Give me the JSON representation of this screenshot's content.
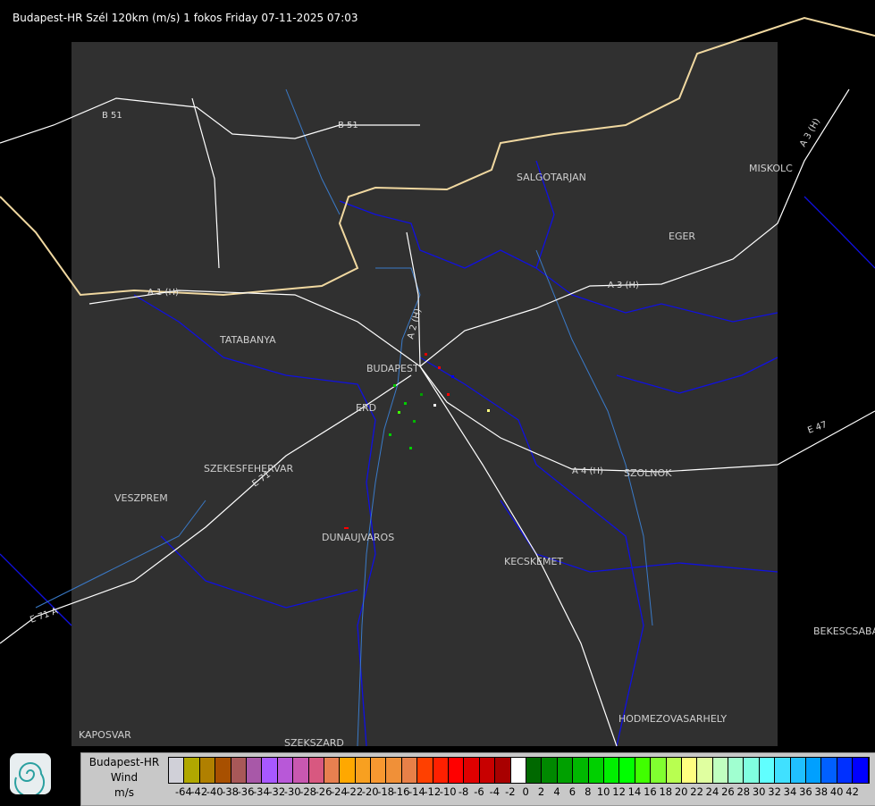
{
  "header": {
    "title": "Budapest-HR Szél 120km (m/s) 1 fokos Friday 07-11-2025 07:03"
  },
  "map": {
    "cities": [
      {
        "name": "SALGOTARJAN"
      },
      {
        "name": "MISKOLC"
      },
      {
        "name": "EGER"
      },
      {
        "name": "TATABANYA"
      },
      {
        "name": "BUDAPEST"
      },
      {
        "name": "ERD"
      },
      {
        "name": "SZEKESFEHERVAR"
      },
      {
        "name": "VESZPREM"
      },
      {
        "name": "DUNAUJVAROS"
      },
      {
        "name": "KECSKEMET"
      },
      {
        "name": "SZOLNOK"
      },
      {
        "name": "BEKESCSABA"
      },
      {
        "name": "HODMEZOVASARHELY"
      },
      {
        "name": "KAPOSVAR"
      },
      {
        "name": "SZEKSZARD"
      }
    ],
    "roads": [
      {
        "name": "B 51"
      },
      {
        "name": "B 51"
      },
      {
        "name": "A 3 (H)"
      },
      {
        "name": "A 3 (H)"
      },
      {
        "name": "A 2 (H)"
      },
      {
        "name": "A 1 (H)"
      },
      {
        "name": "A 4 (H)"
      },
      {
        "name": "E 71"
      },
      {
        "name": "E 71 A"
      },
      {
        "name": "E 47"
      }
    ]
  },
  "legend": {
    "station": "Budapest-HR",
    "quantity": "Wind",
    "unit": "m/s",
    "colors": [
      "#d0d0d8",
      "#b0a800",
      "#b08000",
      "#a85000",
      "#a85858",
      "#a858a8",
      "#a858ff",
      "#b858d8",
      "#c858b0",
      "#d85880",
      "#e88050",
      "#ffa800",
      "#f8a020",
      "#f89830",
      "#f09038",
      "#e88048",
      "#ff4000",
      "#ff2000",
      "#ff0000",
      "#e00000",
      "#c80000",
      "#a80000",
      "#ffffff",
      "#006800",
      "#008800",
      "#00a000",
      "#00b800",
      "#00d000",
      "#00f000",
      "#00ff00",
      "#40ff00",
      "#80ff30",
      "#b8ff50",
      "#ffff80",
      "#e0ffa0",
      "#c0ffc0",
      "#a0ffd0",
      "#80ffe0",
      "#60ffff",
      "#40e0ff",
      "#20c0ff",
      "#00a0ff",
      "#0060ff",
      "#0030ff",
      "#0000ff"
    ],
    "ticks": [
      "-64",
      "-42",
      "-40",
      "-38",
      "-36",
      "-34",
      "-32",
      "-30",
      "-28",
      "-26",
      "-24",
      "-22",
      "-20",
      "-18",
      "-16",
      "-14",
      "-12",
      "-10",
      "-8",
      "-6",
      "-4",
      "-2",
      "0",
      "2",
      "4",
      "6",
      "8",
      "10",
      "12",
      "14",
      "16",
      "18",
      "20",
      "22",
      "24",
      "26",
      "28",
      "30",
      "32",
      "34",
      "36",
      "38",
      "40",
      "42"
    ]
  }
}
